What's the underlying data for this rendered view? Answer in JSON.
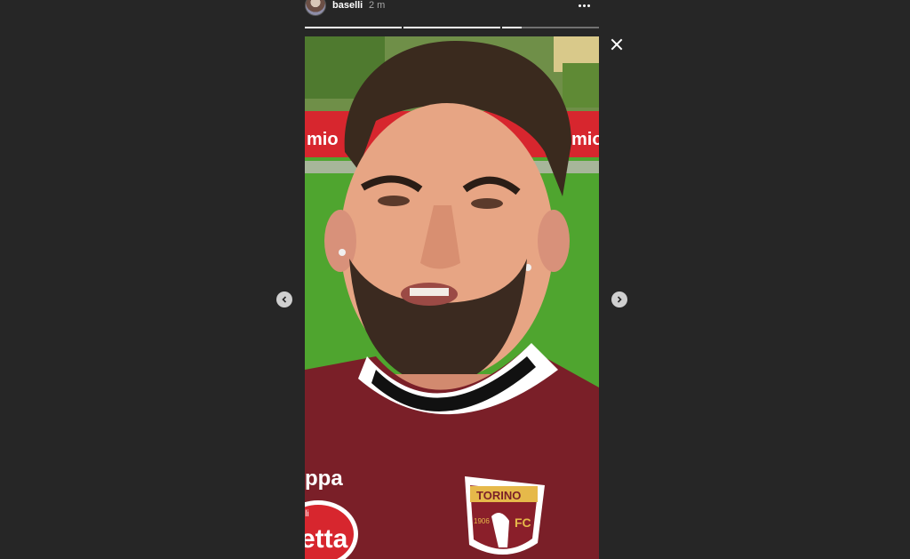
{
  "story": {
    "username": "baselli",
    "timestamp": "2 m",
    "progress": [
      1.0,
      1.0,
      0.2
    ]
  },
  "media": {
    "left_banner_text": "mio",
    "right_banner_text": "mio",
    "shirt_sponsor_text": "ppa",
    "shirt_front_text": "etta",
    "shirt_small_text": "lli",
    "crest_title": "TORINO",
    "crest_year": "1906",
    "crest_letters": "FC"
  },
  "colors": {
    "background": "#262626",
    "jersey": "#7a1f28",
    "banner": "#d7262e",
    "pitch": "#4fa52f"
  }
}
